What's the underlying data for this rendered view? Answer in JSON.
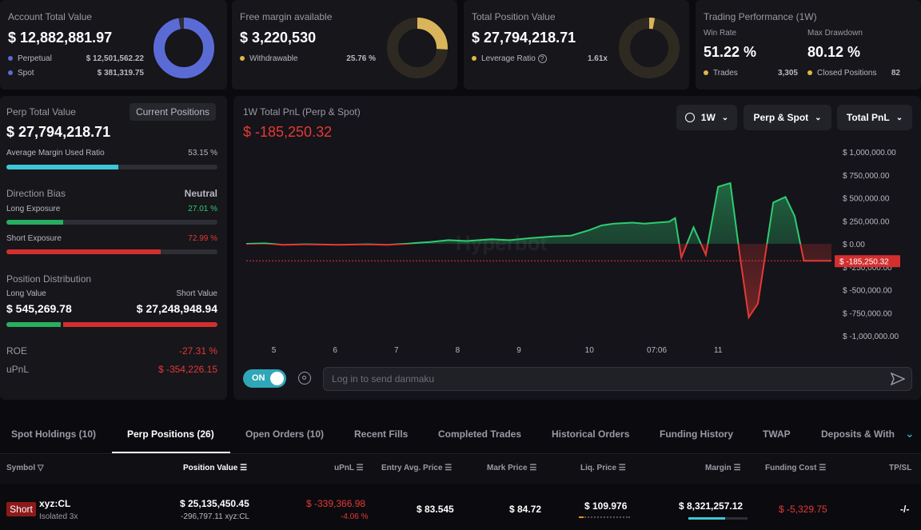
{
  "summary": {
    "account": {
      "title": "Account Total Value",
      "value": "$ 12,882,881.97",
      "rows": [
        {
          "label": "Perpetual",
          "value": "$ 12,501,562.22"
        },
        {
          "label": "Spot",
          "value": "$ 381,319.75"
        }
      ],
      "ring_fraction": 0.97
    },
    "free_margin": {
      "title": "Free margin available",
      "value": "$ 3,220,530",
      "rows": [
        {
          "label": "Withdrawable",
          "value": "25.76 %"
        }
      ],
      "ring_fraction": 0.2576
    },
    "position": {
      "title": "Total Position Value",
      "value": "$ 27,794,218.71",
      "rows": [
        {
          "label": "Leverage Ratio",
          "value": "1.61x"
        }
      ],
      "ring_fraction": 0.03
    },
    "performance": {
      "title": "Trading Performance (1W)",
      "win_rate_label": "Win Rate",
      "win_rate": "51.22 %",
      "drawdown_label": "Max Drawdown",
      "drawdown": "80.12 %",
      "trades_label": "Trades",
      "trades": "3,305",
      "closed_label": "Closed Positions",
      "closed": "82"
    }
  },
  "perp": {
    "title": "Perp Total Value",
    "button": "Current Positions",
    "value": "$ 27,794,218.71",
    "margin_label": "Average Margin Used Ratio",
    "margin_value": "53.15 %",
    "margin_fraction": 0.5315,
    "direction_label": "Direction Bias",
    "direction_value": "Neutral",
    "long_label": "Long Exposure",
    "long_value": "27.01 %",
    "long_fraction": 0.2701,
    "short_label": "Short Exposure",
    "short_value": "72.99 %",
    "short_fraction": 0.7299,
    "dist_label": "Position Distribution",
    "long_val_label": "Long Value",
    "short_val_label": "Short Value",
    "long_val": "$ 545,269.78",
    "short_val": "$ 27,248,948.94",
    "dist_long_fraction": 0.27,
    "roe_label": "ROE",
    "roe": "-27.31 %",
    "upnl_label": "uPnL",
    "upnl": "$ -354,226.15"
  },
  "chart": {
    "title": "1W Total PnL (Perp & Spot)",
    "value": "$ -185,250.32",
    "dd_period": "1W",
    "dd_scope": "Perp & Spot",
    "dd_metric": "Total PnL",
    "watermark": "Hyperbot",
    "toggle": "ON",
    "danmaku_placeholder": "Log in to send danmaku",
    "colors": {
      "pos": "#2ecc71",
      "neg": "#e53935"
    }
  },
  "chart_data": {
    "type": "area",
    "title": "1W Total PnL (Perp & Spot)",
    "x_ticks": [
      "5",
      "6",
      "7",
      "8",
      "9",
      "10",
      "07:06",
      "11"
    ],
    "y_ticks": [
      "$ 1,000,000.00",
      "$ 750,000.00",
      "$ 500,000.00",
      "$ 250,000.00",
      "$ 0.00",
      "$ -250,000.00",
      "$ -500,000.00",
      "$ -750,000.00",
      "$ -1,000,000.00"
    ],
    "ylim": [
      -1000000,
      1000000
    ],
    "current_label": "$ -185,250.32",
    "current_value": -185250.32,
    "x": [
      0,
      0.3,
      0.6,
      1,
      1.5,
      2,
      2.3,
      2.6,
      2.8,
      3,
      3.3,
      3.6,
      4,
      4.3,
      4.6,
      5,
      5.3,
      5.6,
      5.8,
      6,
      6.3,
      6.5,
      6.7,
      6.9,
      7.0,
      7.1,
      7.3,
      7.5,
      7.7,
      7.9,
      8.05,
      8.2,
      8.35,
      8.6,
      8.8,
      8.95,
      9.1,
      9.3,
      9.45,
      9.55
    ],
    "y": [
      0,
      5000,
      -10000,
      -5000,
      -10000,
      -5000,
      -10000,
      0,
      10000,
      20000,
      40000,
      30000,
      50000,
      40000,
      60000,
      80000,
      90000,
      150000,
      200000,
      220000,
      230000,
      220000,
      230000,
      240000,
      280000,
      -150000,
      180000,
      -120000,
      620000,
      660000,
      -100000,
      -800000,
      -650000,
      450000,
      510000,
      300000,
      -185250,
      -185250,
      -185250,
      -185250
    ],
    "grid": false
  },
  "tabs": [
    "Spot Holdings (10)",
    "Perp Positions (26)",
    "Open Orders (10)",
    "Recent Fills",
    "Completed Trades",
    "Historical Orders",
    "Funding History",
    "TWAP",
    "Deposits & With"
  ],
  "table": {
    "headers": [
      "Symbol",
      "Position Value",
      "uPnL",
      "Entry Avg. Price",
      "Mark Price",
      "Liq. Price",
      "Margin",
      "Funding Cost",
      "TP/SL"
    ],
    "row": {
      "side": "Short",
      "symbol": "xyz:CL",
      "mode": "Isolated 3x",
      "value": "$ 25,135,450.45",
      "size": "-296,797.11 xyz:CL",
      "upnl": "$ -339,366.98",
      "upnl_pct": "-4.06 %",
      "entry": "$ 83.545",
      "mark": "$ 84.72",
      "liq": "$ 109.976",
      "margin": "$ 8,321,257.12",
      "margin_fraction": 0.62,
      "funding": "$ -5,329.75",
      "tpsl": "-/-"
    }
  }
}
